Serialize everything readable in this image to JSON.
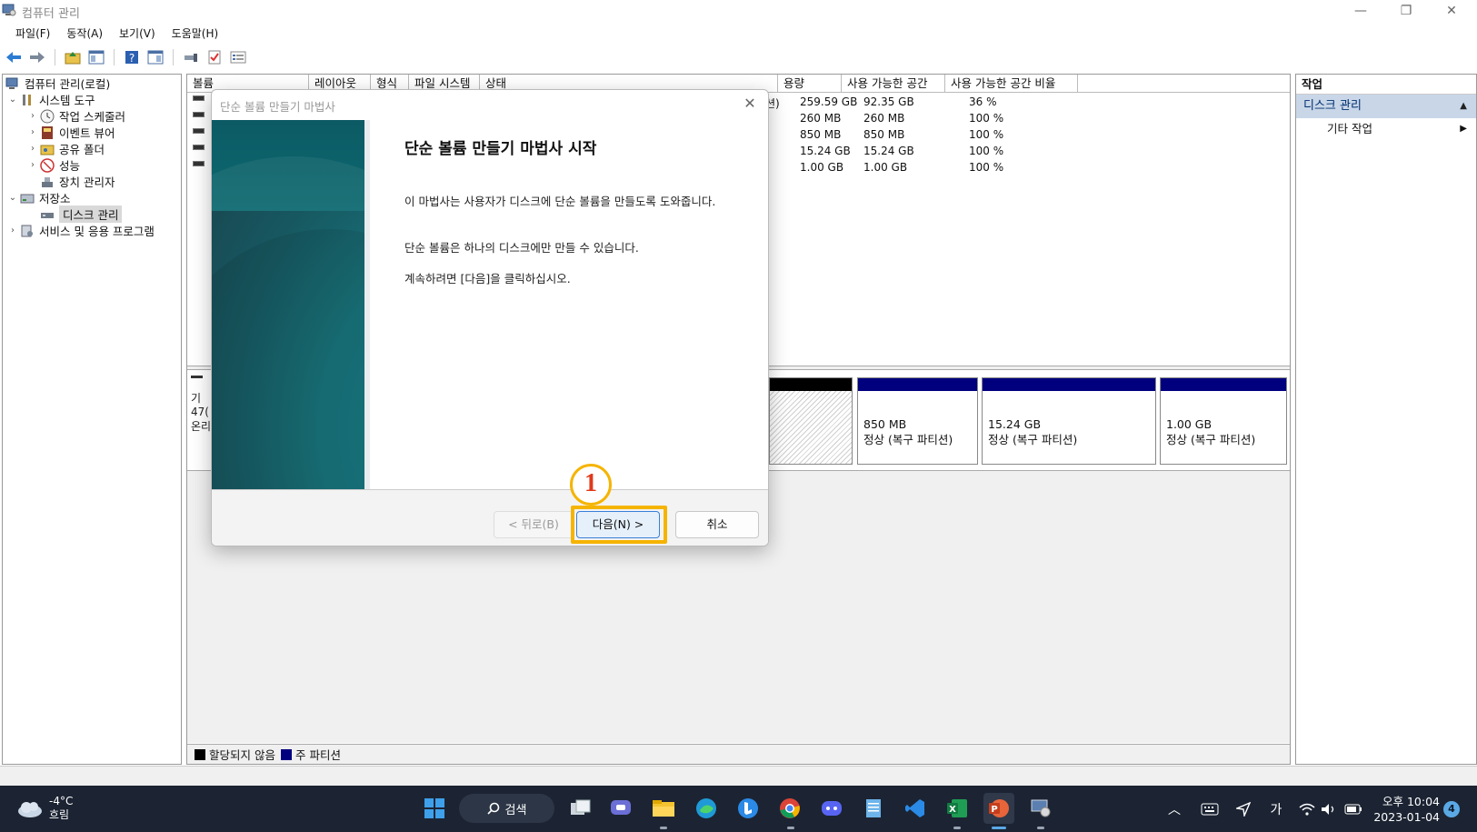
{
  "window": {
    "title": "컴퓨터 관리",
    "minimize": "—",
    "restore": "❐",
    "close": "✕"
  },
  "menu": [
    "파일(F)",
    "동작(A)",
    "보기(V)",
    "도움말(H)"
  ],
  "tree": {
    "root": "컴퓨터 관리(로컬)",
    "system_tools": "시스템 도구",
    "task_scheduler": "작업 스케줄러",
    "event_viewer": "이벤트 뷰어",
    "shared_folders": "공유 폴더",
    "performance": "성능",
    "device_manager": "장치 관리자",
    "storage": "저장소",
    "disk_management": "디스크 관리",
    "services_apps": "서비스 및 응용 프로그램"
  },
  "columns": [
    "볼륨",
    "레이아웃",
    "형식",
    "파일 시스템",
    "상태",
    "용량",
    "사용 가능한 공간",
    "사용 가능한 공간 비율"
  ],
  "volumes": [
    {
      "status_tail": "션)",
      "capacity": "259.59 GB",
      "free": "92.35 GB",
      "pct": "36 %"
    },
    {
      "status_tail": "",
      "capacity": "260 MB",
      "free": "260 MB",
      "pct": "100 %"
    },
    {
      "status_tail": "",
      "capacity": "850 MB",
      "free": "850 MB",
      "pct": "100 %"
    },
    {
      "status_tail": "",
      "capacity": "15.24 GB",
      "free": "15.24 GB",
      "pct": "100 %"
    },
    {
      "status_tail": "",
      "capacity": "1.00 GB",
      "free": "1.00 GB",
      "pct": "100 %"
    }
  ],
  "disk": {
    "label_partial": [
      "기",
      "47(",
      "온리"
    ],
    "partitions": [
      {
        "size": "850 MB",
        "status": "정상 (복구 파티션)"
      },
      {
        "size": "15.24 GB",
        "status": "정상 (복구 파티션)"
      },
      {
        "size": "1.00 GB",
        "status": "정상 (복구 파티션)"
      }
    ]
  },
  "legend": {
    "unallocated": "할당되지 않음",
    "primary": "주 파티션"
  },
  "actions": {
    "header": "작업",
    "group": "디스크 관리",
    "more": "기타 작업"
  },
  "dialog": {
    "title": "단순 볼륨 만들기 마법사",
    "heading": "단순 볼륨 만들기 마법사 시작",
    "para1": "이 마법사는 사용자가 디스크에 단순 볼륨을 만들도록 도와줍니다.",
    "para2": "단순 볼륨은 하나의 디스크에만 만들 수 있습니다.",
    "para3": "계속하려면 [다음]을 클릭하십시오.",
    "back": "< 뒤로(B)",
    "next": "다음(N) >",
    "cancel": "취소",
    "step": "1"
  },
  "taskbar": {
    "temp": "-4°C",
    "weather": "흐림",
    "search": "검색",
    "ime": "가",
    "time": "오후 10:04",
    "date": "2023-01-04",
    "notifications": "4"
  },
  "colors": {
    "primary_partition": "#00007f",
    "unallocated": "#000000",
    "highlight": "#f5b400",
    "badge_text": "#e03a1a"
  }
}
